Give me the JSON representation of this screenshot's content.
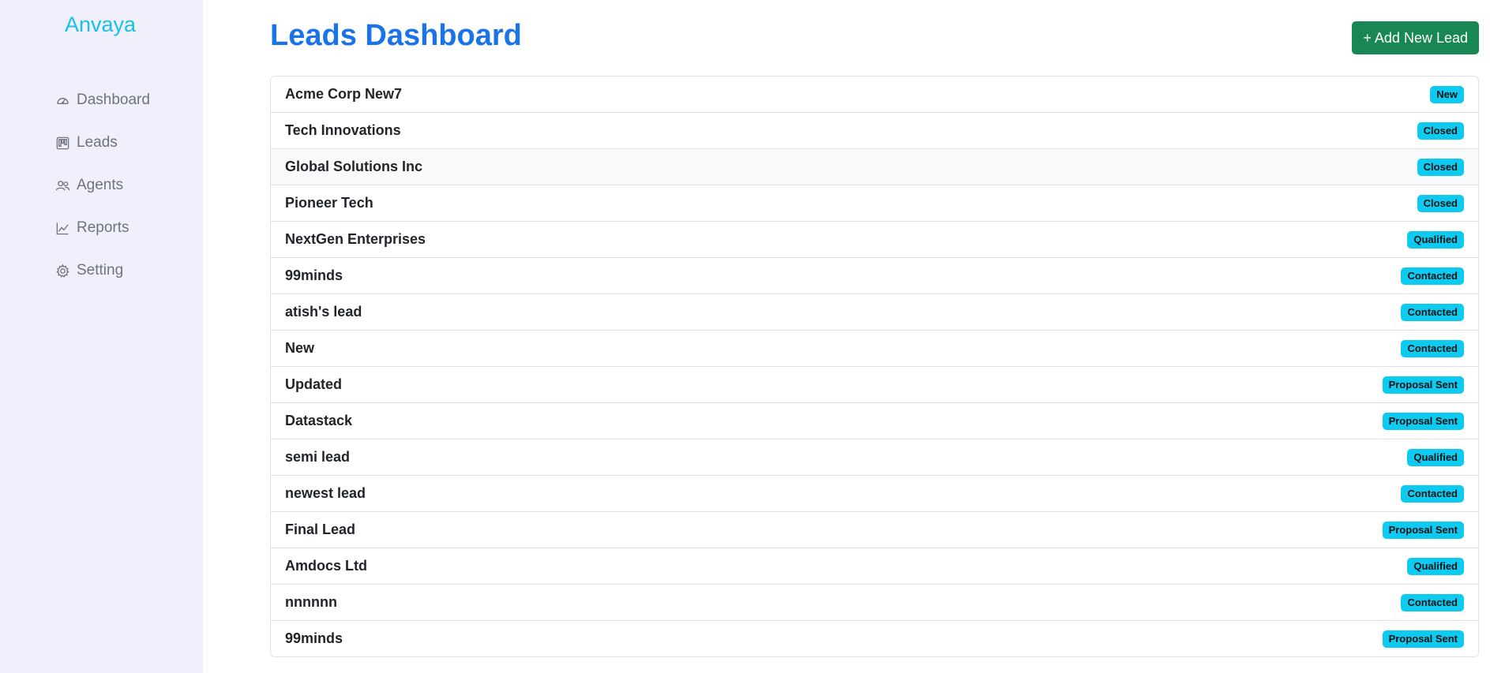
{
  "sidebar": {
    "brand": "Anvaya",
    "items": [
      {
        "label": "Dashboard",
        "icon": "speedometer-icon"
      },
      {
        "label": "Leads",
        "icon": "kanban-icon"
      },
      {
        "label": "Agents",
        "icon": "people-icon"
      },
      {
        "label": "Reports",
        "icon": "graph-icon"
      },
      {
        "label": "Setting",
        "icon": "gear-icon"
      }
    ]
  },
  "header": {
    "title": "Leads Dashboard",
    "add_button_label": "+ Add New Lead"
  },
  "leads": [
    {
      "name": "Acme Corp New7",
      "status": "New"
    },
    {
      "name": "Tech Innovations",
      "status": "Closed"
    },
    {
      "name": "Global Solutions Inc",
      "status": "Closed"
    },
    {
      "name": "Pioneer Tech",
      "status": "Closed"
    },
    {
      "name": "NextGen Enterprises",
      "status": "Qualified"
    },
    {
      "name": "99minds",
      "status": "Contacted"
    },
    {
      "name": "atish's lead",
      "status": "Contacted"
    },
    {
      "name": "New",
      "status": "Contacted"
    },
    {
      "name": "Updated",
      "status": "Proposal Sent"
    },
    {
      "name": "Datastack",
      "status": "Proposal Sent"
    },
    {
      "name": "semi lead",
      "status": "Qualified"
    },
    {
      "name": "newest lead",
      "status": "Contacted"
    },
    {
      "name": "Final Lead",
      "status": "Proposal Sent"
    },
    {
      "name": "Amdocs Ltd",
      "status": "Qualified"
    },
    {
      "name": "nnnnnn",
      "status": "Contacted"
    },
    {
      "name": "99minds",
      "status": "Proposal Sent"
    }
  ],
  "colors": {
    "brand": "#17c0e6",
    "title": "#1a73e8",
    "add_button": "#198754",
    "badge": "#0dcaf0",
    "sidebar_bg": "#f1effc"
  }
}
